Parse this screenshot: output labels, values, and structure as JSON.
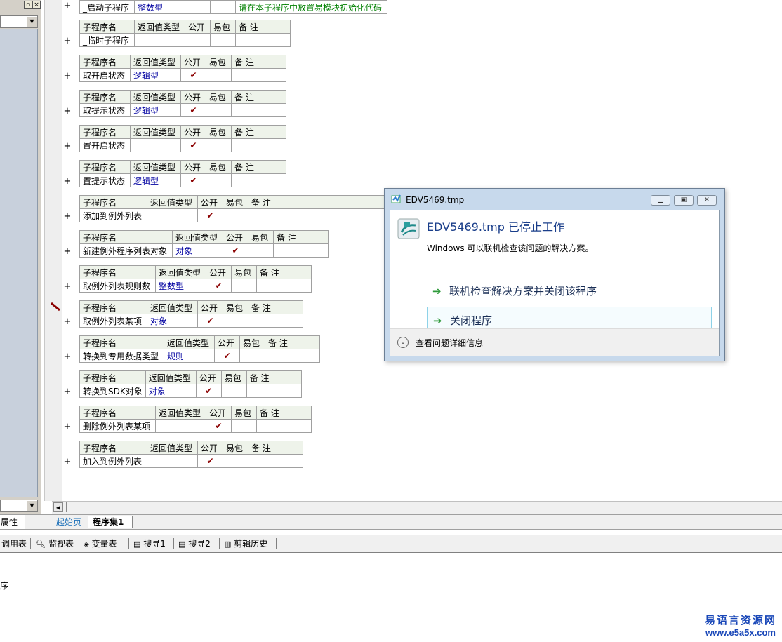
{
  "left_panel": {
    "tab_label": "属性"
  },
  "table_header": {
    "col_name": "子程序名",
    "col_return": "返回值类型",
    "col_public": "公开",
    "col_easy": "易包",
    "col_note": "备 注"
  },
  "check_mark": "✔",
  "first_row": {
    "name": "_启动子程序",
    "return_type": "整数型",
    "note": "请在本子程序中放置易模块初始化代码"
  },
  "subroutines": [
    {
      "name": "_临时子程序",
      "return_type": "",
      "public": false
    },
    {
      "name": "取开启状态",
      "return_type": "逻辑型",
      "public": true
    },
    {
      "name": "取提示状态",
      "return_type": "逻辑型",
      "public": true
    },
    {
      "name": "置开启状态",
      "return_type": "",
      "public": true
    },
    {
      "name": "置提示状态",
      "return_type": "逻辑型",
      "public": true
    },
    {
      "name": "添加到例外列表",
      "return_type": "",
      "public": true
    },
    {
      "name": "新建例外程序列表对象",
      "return_type": "对象",
      "public": true
    },
    {
      "name": "取例外列表规则数",
      "return_type": "整数型",
      "public": true
    },
    {
      "name": "取例外列表某项",
      "return_type": "对象",
      "public": true
    },
    {
      "name": "转换到专用数据类型",
      "return_type": "规则",
      "public": true
    },
    {
      "name": "转换到SDK对象",
      "return_type": "对象",
      "public": true
    },
    {
      "name": "删除例外列表某项",
      "return_type": "",
      "public": true
    },
    {
      "name": "加入到例外列表",
      "return_type": "",
      "public": true
    }
  ],
  "plus_sign": "+",
  "tabs": {
    "start_page": "起始页",
    "program_set": "程序集1"
  },
  "toolbar": {
    "call_table": "调用表",
    "watch_table": "监视表",
    "var_table": "变量表",
    "search1": "搜寻1",
    "search2": "搜寻2",
    "clip_history": "剪辑历史"
  },
  "bottom_text": "序",
  "dialog": {
    "title": "EDV5469.tmp",
    "heading": "EDV5469.tmp 已停止工作",
    "description": "Windows 可以联机检查该问题的解决方案。",
    "option1": "联机检查解决方案并关闭该程序",
    "option2": "关闭程序",
    "details": "查看问题详细信息"
  },
  "watermark": {
    "line1": "易语言资源网",
    "line2": "www.e5a5x.com"
  },
  "colors": {
    "return_type_text": "#0000a0",
    "note_text": "#008000",
    "check_mark": "#8b0000",
    "dialog_heading": "#1a3e8a"
  }
}
